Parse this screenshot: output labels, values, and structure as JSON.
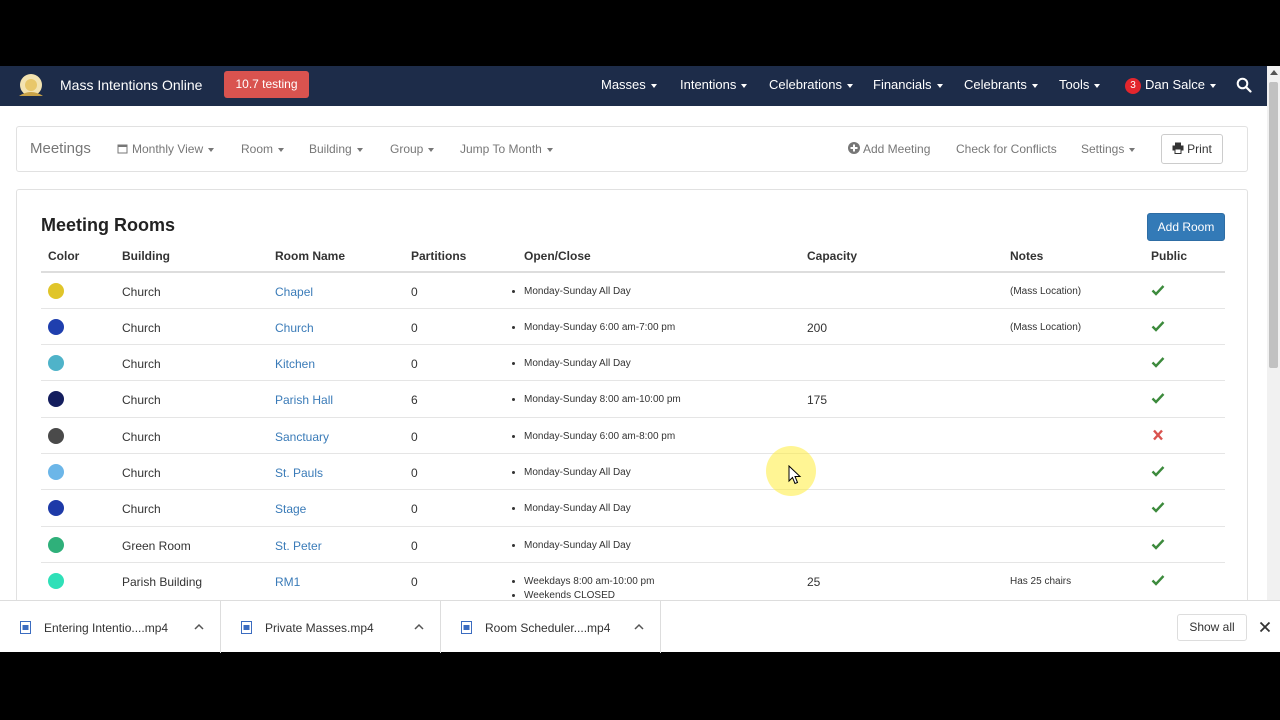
{
  "app": {
    "name": "Mass Intentions Online",
    "badge": "10.7 testing"
  },
  "topnav": {
    "items": [
      {
        "label": "Masses"
      },
      {
        "label": "Intentions"
      },
      {
        "label": "Celebrations"
      },
      {
        "label": "Financials"
      },
      {
        "label": "Celebrants"
      },
      {
        "label": "Tools"
      }
    ],
    "notifications": "3",
    "user": "Dan Salce"
  },
  "subnav": {
    "title": "Meetings",
    "monthly_view": "Monthly View",
    "room": "Room",
    "building": "Building",
    "group": "Group",
    "jump": "Jump To Month",
    "add_meeting": "Add Meeting",
    "check_conflicts": "Check for Conflicts",
    "settings": "Settings",
    "print": "Print"
  },
  "panel": {
    "title": "Meeting Rooms",
    "add_button": "Add Room",
    "columns": [
      "Color",
      "Building",
      "Room Name",
      "Partitions",
      "Open/Close",
      "Capacity",
      "Notes",
      "Public"
    ],
    "rows": [
      {
        "color": "#e0c52a",
        "building": "Church",
        "room": "Chapel",
        "partitions": "0",
        "hours": [
          "Monday-Sunday All Day"
        ],
        "capacity": "",
        "notes": "(Mass Location)",
        "public": true
      },
      {
        "color": "#1f3fae",
        "building": "Church",
        "room": "Church",
        "partitions": "0",
        "hours": [
          "Monday-Sunday 6:00 am-7:00 pm"
        ],
        "capacity": "200",
        "notes": "(Mass Location)",
        "public": true
      },
      {
        "color": "#4fb3c9",
        "building": "Church",
        "room": "Kitchen",
        "partitions": "0",
        "hours": [
          "Monday-Sunday All Day"
        ],
        "capacity": "",
        "notes": "",
        "public": true
      },
      {
        "color": "#141e5e",
        "building": "Church",
        "room": "Parish Hall",
        "partitions": "6",
        "hours": [
          "Monday-Sunday 8:00 am-10:00 pm"
        ],
        "capacity": "175",
        "notes": "",
        "public": true
      },
      {
        "color": "#4a4a4a",
        "building": "Church",
        "room": "Sanctuary",
        "partitions": "0",
        "hours": [
          "Monday-Sunday 6:00 am-8:00 pm"
        ],
        "capacity": "",
        "notes": "",
        "public": false
      },
      {
        "color": "#6cb6e8",
        "building": "Church",
        "room": "St. Pauls",
        "partitions": "0",
        "hours": [
          "Monday-Sunday All Day"
        ],
        "capacity": "",
        "notes": "",
        "public": true
      },
      {
        "color": "#1e3aa8",
        "building": "Church",
        "room": "Stage",
        "partitions": "0",
        "hours": [
          "Monday-Sunday All Day"
        ],
        "capacity": "",
        "notes": "",
        "public": true
      },
      {
        "color": "#2fb07a",
        "building": "Green Room",
        "room": "St. Peter",
        "partitions": "0",
        "hours": [
          "Monday-Sunday All Day"
        ],
        "capacity": "",
        "notes": "",
        "public": true
      },
      {
        "color": "#2fe0b8",
        "building": "Parish Building",
        "room": "RM1",
        "partitions": "0",
        "hours": [
          "Weekdays 8:00 am-10:00 pm",
          "Weekends CLOSED"
        ],
        "capacity": "25",
        "notes": "Has 25 chairs",
        "public": true
      }
    ]
  },
  "downloads": {
    "files": [
      "Entering Intentio....mp4",
      "Private Masses.mp4",
      "Room Scheduler....mp4"
    ],
    "show_all": "Show all"
  },
  "colors": {
    "navbar": "#1d2c49",
    "badge": "#d9534f",
    "primary": "#337ab7",
    "link": "#3a7bb8",
    "check": "#3c8a3c",
    "cross": "#d9534f"
  }
}
